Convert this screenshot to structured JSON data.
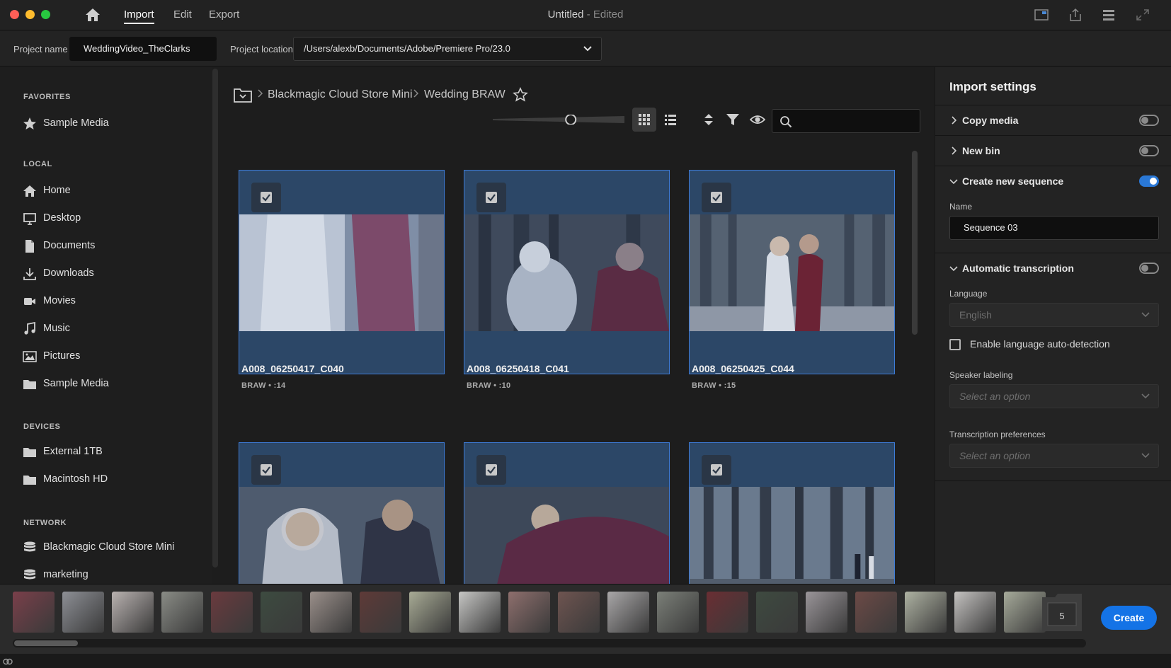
{
  "window": {
    "title": "Untitled",
    "title_suffix": "- Edited"
  },
  "nav": {
    "import": "Import",
    "edit": "Edit",
    "export": "Export"
  },
  "project": {
    "name_label": "Project name",
    "name_value": "WeddingVideo_TheClarks",
    "location_label": "Project location",
    "location_value": "/Users/alexb/Documents/Adobe/Premiere Pro/23.0"
  },
  "sidebar": {
    "sections": {
      "favorites": "FAVORITES",
      "local": "LOCAL",
      "devices": "DEVICES",
      "network": "NETWORK"
    },
    "favorites": [
      {
        "label": "Sample Media",
        "icon": "star-icon"
      }
    ],
    "local": [
      {
        "label": "Home",
        "icon": "home-icon"
      },
      {
        "label": "Desktop",
        "icon": "desktop-icon"
      },
      {
        "label": "Documents",
        "icon": "document-icon"
      },
      {
        "label": "Downloads",
        "icon": "download-icon"
      },
      {
        "label": "Movies",
        "icon": "movie-camera-icon"
      },
      {
        "label": "Music",
        "icon": "music-note-icon"
      },
      {
        "label": "Pictures",
        "icon": "picture-icon"
      },
      {
        "label": "Sample Media",
        "icon": "folder-icon"
      }
    ],
    "devices": [
      {
        "label": "External 1TB",
        "icon": "folder-icon"
      },
      {
        "label": "Macintosh HD",
        "icon": "folder-icon"
      }
    ],
    "network": [
      {
        "label": "Blackmagic Cloud Store Mini",
        "icon": "database-icon"
      },
      {
        "label": "marketing",
        "icon": "database-icon"
      }
    ]
  },
  "breadcrumb": {
    "parent": "Blackmagic Cloud Store Mini",
    "current": "Wedding BRAW"
  },
  "view": {
    "zoom": 0.6,
    "mode": "grid"
  },
  "clips": [
    {
      "name": "A008_06250417_C040",
      "meta": "BRAW • :14"
    },
    {
      "name": "A008_06250418_C041",
      "meta": "BRAW • :10"
    },
    {
      "name": "A008_06250425_C044",
      "meta": "BRAW • :15"
    },
    {
      "name": "",
      "meta": ""
    },
    {
      "name": "",
      "meta": ""
    },
    {
      "name": "",
      "meta": ""
    }
  ],
  "import_settings": {
    "title": "Import settings",
    "copy_media": {
      "label": "Copy media",
      "enabled": false
    },
    "new_bin": {
      "label": "New bin",
      "enabled": false
    },
    "create_sequence": {
      "label": "Create new sequence",
      "enabled": true,
      "name_label": "Name",
      "name_value": "Sequence 03"
    },
    "transcription": {
      "label": "Automatic transcription",
      "enabled": false,
      "language_label": "Language",
      "language_value": "English",
      "autodetect_label": "Enable language auto-detection",
      "speaker_label": "Speaker labeling",
      "speaker_placeholder": "Select an option",
      "prefs_label": "Transcription preferences",
      "prefs_placeholder": "Select an option"
    }
  },
  "tray": {
    "count": "5",
    "create_label": "Create"
  },
  "colors": {
    "accent": "#1473e6",
    "selection": "#3d7bd6",
    "card_bg": "#2c4767"
  }
}
